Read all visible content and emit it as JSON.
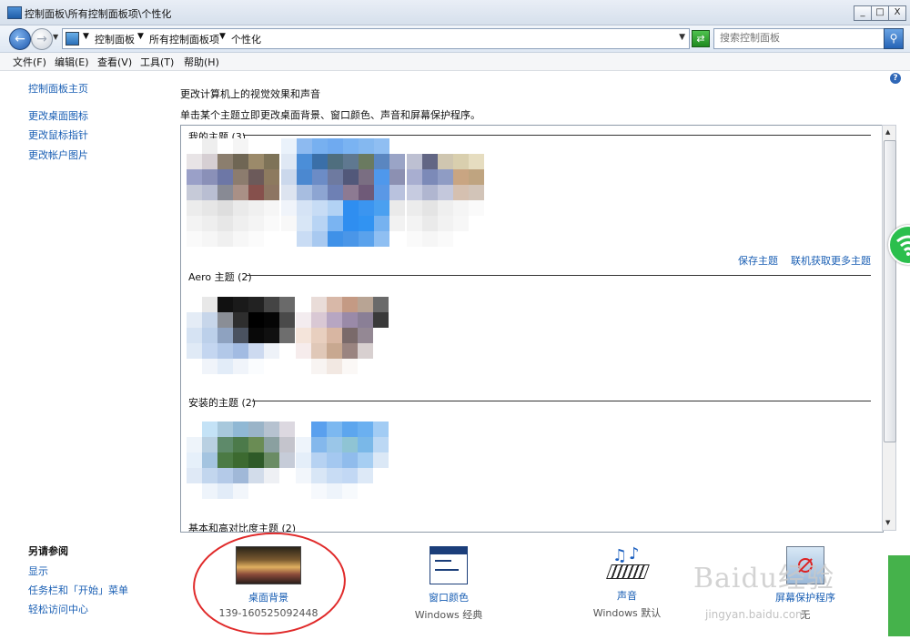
{
  "window": {
    "title": "控制面板\\所有控制面板项\\个性化",
    "min": "_",
    "max": "□",
    "close": "X"
  },
  "address": {
    "crumbs": [
      "控制面板",
      "所有控制面板项",
      "个性化"
    ],
    "search_placeholder": "搜索控制面板"
  },
  "menu": [
    "文件(F)",
    "编辑(E)",
    "查看(V)",
    "工具(T)",
    "帮助(H)"
  ],
  "sidebar": {
    "home": "控制面板主页",
    "links": [
      "更改桌面图标",
      "更改鼠标指针",
      "更改帐户图片"
    ],
    "see_also_title": "另请参阅",
    "see_also": [
      "显示",
      "任务栏和「开始」菜单",
      "轻松访问中心"
    ]
  },
  "main": {
    "title": "更改计算机上的视觉效果和声音",
    "subtitle": "单击某个主题立即更改桌面背景、窗口颜色、声音和屏幕保护程序。",
    "sections": {
      "my": "我的主题 (3)",
      "aero": "Aero 主题 (2)",
      "installed": "安装的主题 (2)",
      "basic": "基本和高对比度主题 (2)"
    },
    "save_theme": "保存主题",
    "get_more": "联机获取更多主题"
  },
  "bottom": [
    {
      "label": "桌面背景",
      "sub": "139-160525092448",
      "icon": "desktop-background-icon"
    },
    {
      "label": "窗口颜色",
      "sub": "Windows 经典",
      "icon": "window-color-icon"
    },
    {
      "label": "声音",
      "sub": "Windows 默认",
      "icon": "sound-icon"
    },
    {
      "label": "屏幕保护程序",
      "sub": "无",
      "icon": "screensaver-icon"
    }
  ],
  "watermark": {
    "brand": "Baidu经验",
    "url": "jingyan.baidu.com"
  },
  "colors": {
    "link": "#1a5fb4",
    "annotation": "#e02a2a"
  }
}
